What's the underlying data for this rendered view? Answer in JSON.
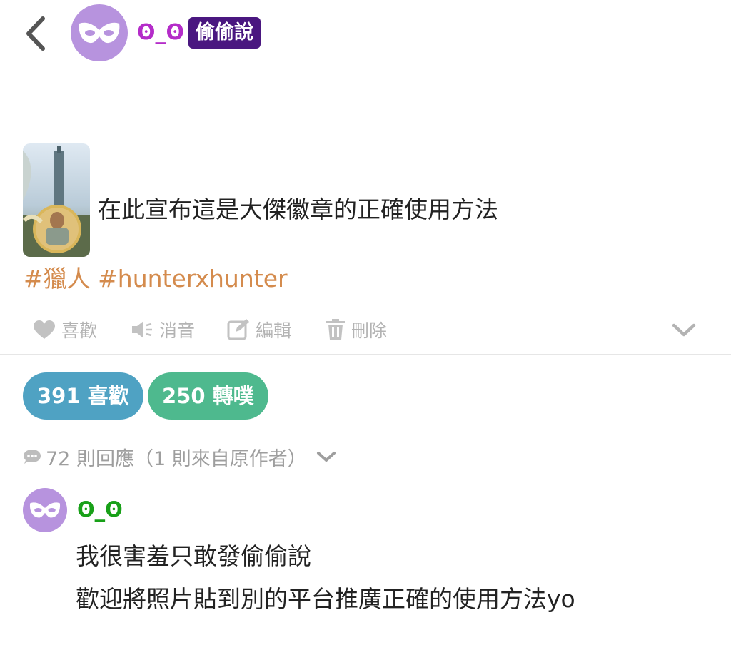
{
  "header": {
    "author_name": "ʘ_ʘ",
    "badge": "偷偷說",
    "colors": {
      "avatar_bg": "#b793de",
      "author_name": "#b42cc9",
      "badge_bg": "#4a1780"
    }
  },
  "post": {
    "text": "在此宣布這是大傑徽章的正確使用方法",
    "tags": [
      "#獵人",
      "#hunterxhunter"
    ],
    "image_desc_icon": "photo-thumbnail",
    "colors": {
      "tags": "#d48b4d"
    }
  },
  "actions": {
    "like": "喜歡",
    "mute": "消音",
    "edit": "編輯",
    "delete": "刪除"
  },
  "stats": {
    "likes": "391 喜歡",
    "replurks": "250 轉噗",
    "colors": {
      "likes": "#4fa2c3",
      "replurks": "#4eb98e"
    }
  },
  "responses": {
    "summary": "72 則回應（1 則來自原作者）"
  },
  "comment": {
    "author_name": "ʘ_ʘ",
    "lines": [
      "我很害羞只敢發偷偷說",
      "歡迎將照片貼到別的平台推廣正確的使用方法yo"
    ],
    "colors": {
      "author_name": "#18a018"
    }
  }
}
